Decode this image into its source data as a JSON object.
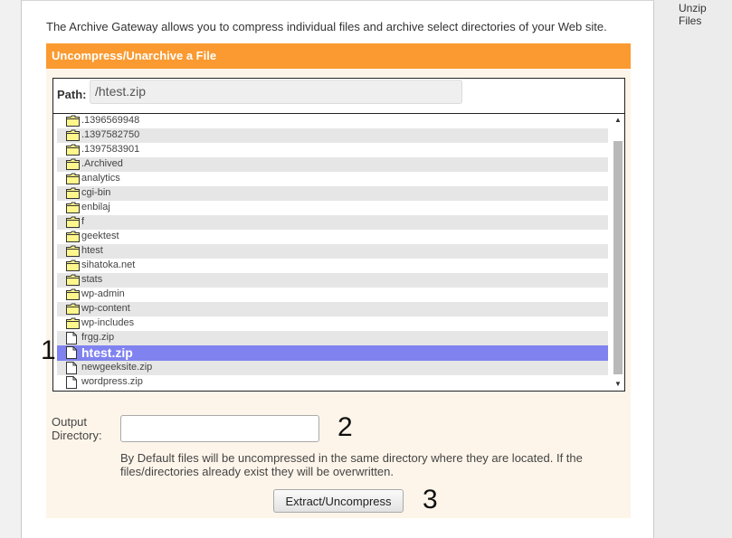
{
  "sidebar": {
    "link_label": "Unzip Files"
  },
  "intro_text": "The Archive Gateway allows you to compress individual files and archive select directories of your Web site.",
  "section": {
    "title": "Uncompress/Unarchive a File"
  },
  "path": {
    "label": "Path:",
    "value": "/htest.zip"
  },
  "file_list": {
    "items": [
      {
        "name": ".1396569948",
        "type": "folder"
      },
      {
        "name": ".1397582750",
        "type": "folder"
      },
      {
        "name": ".1397583901",
        "type": "folder"
      },
      {
        "name": ".Archived",
        "type": "folder"
      },
      {
        "name": "analytics",
        "type": "folder"
      },
      {
        "name": "cgi-bin",
        "type": "folder"
      },
      {
        "name": "enbilaj",
        "type": "folder"
      },
      {
        "name": "f",
        "type": "folder"
      },
      {
        "name": "geektest",
        "type": "folder"
      },
      {
        "name": "htest",
        "type": "folder"
      },
      {
        "name": "sihatoka.net",
        "type": "folder"
      },
      {
        "name": "stats",
        "type": "folder"
      },
      {
        "name": "wp-admin",
        "type": "folder"
      },
      {
        "name": "wp-content",
        "type": "folder"
      },
      {
        "name": "wp-includes",
        "type": "folder"
      },
      {
        "name": "frgg.zip",
        "type": "file"
      },
      {
        "name": "htest.zip",
        "type": "file",
        "selected": true
      },
      {
        "name": "newgeeksite.zip",
        "type": "file"
      },
      {
        "name": "wordpress.zip",
        "type": "file"
      }
    ]
  },
  "markers": {
    "one": "1",
    "two": "2",
    "three": "3"
  },
  "output": {
    "label": "Output Directory:",
    "value": "",
    "description": "By Default files will be uncompressed in the same directory where they are located. If the files/directories already exist they will be overwritten."
  },
  "actions": {
    "extract_label": "Extract/Uncompress"
  },
  "icons": {
    "folder": "folder-icon",
    "file": "file-icon",
    "scroll_up": "scroll-up-arrow-icon",
    "scroll_down": "scroll-down-arrow-icon"
  },
  "colors": {
    "header": "#fa9a30",
    "section_bg": "#fef5ea",
    "selected_row": "#8082f0",
    "folder_fill": "#fff78c"
  }
}
